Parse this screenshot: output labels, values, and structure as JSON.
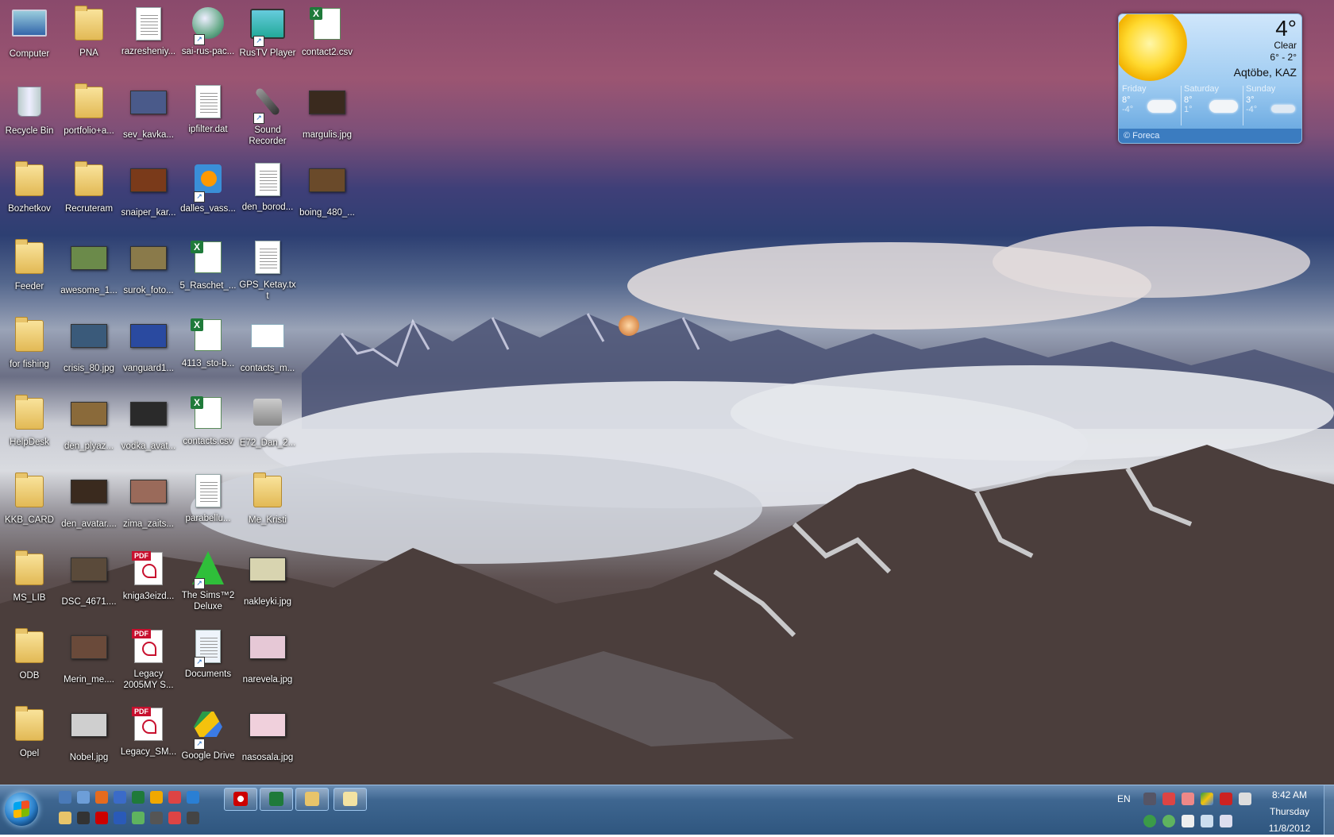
{
  "desktop_icons": [
    {
      "label": "Computer",
      "type": "computer",
      "col": 0,
      "row": 0
    },
    {
      "label": "Recycle Bin",
      "type": "recycle",
      "col": 0,
      "row": 1
    },
    {
      "label": "Bozhetkov",
      "type": "folder",
      "col": 0,
      "row": 2
    },
    {
      "label": "Feeder",
      "type": "folder",
      "col": 0,
      "row": 3
    },
    {
      "label": "for fishing",
      "type": "folder",
      "col": 0,
      "row": 4
    },
    {
      "label": "HelpDesk",
      "type": "folder",
      "col": 0,
      "row": 5
    },
    {
      "label": "KKB_CARD",
      "type": "folder",
      "col": 0,
      "row": 6
    },
    {
      "label": "MS_LIB",
      "type": "folder",
      "col": 0,
      "row": 7
    },
    {
      "label": "ODB",
      "type": "folder",
      "col": 0,
      "row": 8
    },
    {
      "label": "Opel",
      "type": "folder",
      "col": 0,
      "row": 9
    },
    {
      "label": "PNA",
      "type": "folder",
      "col": 1,
      "row": 0
    },
    {
      "label": "portfolio+a...",
      "type": "folder",
      "col": 1,
      "row": 1
    },
    {
      "label": "Recruteram",
      "type": "folder",
      "col": 1,
      "row": 2
    },
    {
      "label": "awesome_1...",
      "type": "photo",
      "color": "#6b8a4a",
      "col": 1,
      "row": 3
    },
    {
      "label": "crisis_80.jpg",
      "type": "photo",
      "color": "#3a5a7a",
      "col": 1,
      "row": 4
    },
    {
      "label": "den_plyaz...",
      "type": "photo",
      "color": "#8a6a3a",
      "col": 1,
      "row": 5
    },
    {
      "label": "den_avatar....",
      "type": "photo",
      "color": "#3a2a1e",
      "col": 1,
      "row": 6
    },
    {
      "label": "DSC_4671....",
      "type": "photo",
      "color": "#5a4a3a",
      "col": 1,
      "row": 7
    },
    {
      "label": "Merin_me....",
      "type": "photo",
      "color": "#6a4a3a",
      "col": 1,
      "row": 8
    },
    {
      "label": "Nobel.jpg",
      "type": "photo",
      "color": "#cfcfcf",
      "col": 1,
      "row": 9
    },
    {
      "label": "razresheniy...",
      "type": "doc",
      "col": 2,
      "row": 0
    },
    {
      "label": "sev_kavka...",
      "type": "photo",
      "color": "#4a5a8a",
      "col": 2,
      "row": 1
    },
    {
      "label": "snaiper_kar...",
      "type": "photo",
      "color": "#7a3a1a",
      "col": 2,
      "row": 2
    },
    {
      "label": "surok_foto...",
      "type": "photo",
      "color": "#8a7a4a",
      "col": 2,
      "row": 3
    },
    {
      "label": "vanguard1...",
      "type": "photo",
      "color": "#2a4aa0",
      "col": 2,
      "row": 4
    },
    {
      "label": "vodka_avat...",
      "type": "photo",
      "color": "#2a2a2a",
      "col": 2,
      "row": 5
    },
    {
      "label": "zima_zaits...",
      "type": "photo",
      "color": "#9a6a5a",
      "col": 2,
      "row": 6
    },
    {
      "label": "kniga3eizd...",
      "type": "pdf",
      "col": 2,
      "row": 7
    },
    {
      "label": "Legacy 2005MY S...",
      "type": "pdf",
      "col": 2,
      "row": 8
    },
    {
      "label": "Legacy_SM...",
      "type": "pdf",
      "col": 2,
      "row": 9
    },
    {
      "label": "sai-rus-pac...",
      "type": "installer",
      "col": 3,
      "row": 0
    },
    {
      "label": "ipfilter.dat",
      "type": "doc",
      "col": 3,
      "row": 1
    },
    {
      "label": "dalles_vass...",
      "type": "media",
      "col": 3,
      "row": 2
    },
    {
      "label": "5_Raschet_...",
      "type": "xls",
      "col": 3,
      "row": 3
    },
    {
      "label": "4113_sto-b...",
      "type": "xls",
      "col": 3,
      "row": 4
    },
    {
      "label": "contacts.csv",
      "type": "xls",
      "col": 3,
      "row": 5
    },
    {
      "label": "parabellu...",
      "type": "mp3",
      "col": 3,
      "row": 6
    },
    {
      "label": "The Sims™2 Deluxe",
      "type": "sims",
      "col": 3,
      "row": 7
    },
    {
      "label": "Documents",
      "type": "documents",
      "col": 3,
      "row": 8
    },
    {
      "label": "Google Drive",
      "type": "gdrive",
      "col": 3,
      "row": 9
    },
    {
      "label": "RusTV Player",
      "type": "tv",
      "col": 4,
      "row": 0
    },
    {
      "label": "Sound Recorder",
      "type": "mic",
      "col": 4,
      "row": 1
    },
    {
      "label": "den_borod...",
      "type": "doc",
      "col": 4,
      "row": 2
    },
    {
      "label": "GPS_Ketay.txt",
      "type": "doc",
      "col": 4,
      "row": 3
    },
    {
      "label": "contacts_m...",
      "type": "contacts",
      "col": 4,
      "row": 4
    },
    {
      "label": "E72_Dan_2...",
      "type": "backup",
      "col": 4,
      "row": 5
    },
    {
      "label": "Me_Kristi",
      "type": "folder",
      "col": 4,
      "row": 6
    },
    {
      "label": "nakleyki.jpg",
      "type": "photo",
      "color": "#d8d4b0",
      "col": 4,
      "row": 7
    },
    {
      "label": "narevela.jpg",
      "type": "photo",
      "color": "#e6c8d6",
      "col": 4,
      "row": 8
    },
    {
      "label": "nasosala.jpg",
      "type": "photo",
      "color": "#f0d0dc",
      "col": 4,
      "row": 9
    },
    {
      "label": "contact2.csv",
      "type": "xls",
      "col": 5,
      "row": 0
    },
    {
      "label": "margulis.jpg",
      "type": "photo",
      "color": "#3a2a1e",
      "col": 5,
      "row": 1
    },
    {
      "label": "boing_480_...",
      "type": "photo",
      "color": "#6a4a2a",
      "col": 5,
      "row": 2
    }
  ],
  "weather": {
    "temperature": "4°",
    "condition": "Clear",
    "range": "6° - 2°",
    "city": "Aqtöbe, KAZ",
    "forecast": [
      {
        "day": "Friday",
        "high": "8°",
        "low": "-4°"
      },
      {
        "day": "Saturday",
        "high": "8°",
        "low": "1°"
      },
      {
        "day": "Sunday",
        "high": "3°",
        "low": "-4°"
      }
    ],
    "credit": "© Foreca"
  },
  "taskbar": {
    "quicklaunch_row1": [
      "show-desktop-icon",
      "remote-desktop-icon",
      "firefox-icon",
      "windows-explorer-icon",
      "excel-icon",
      "outlook-icon",
      "chrome-icon",
      "ie-icon"
    ],
    "quicklaunch_row2": [
      "folder-icon",
      "media-icon",
      "opera-icon",
      "photoshop-icon",
      "qip-icon",
      "lightroom-icon",
      "chrome-icon",
      "gears-icon"
    ],
    "pinned": [
      "opera-icon",
      "excel-icon",
      "explorer-icon",
      "mail-icon"
    ],
    "language": "EN",
    "time": "8:42 AM",
    "day": "Thursday",
    "date": "11/8/2012"
  }
}
